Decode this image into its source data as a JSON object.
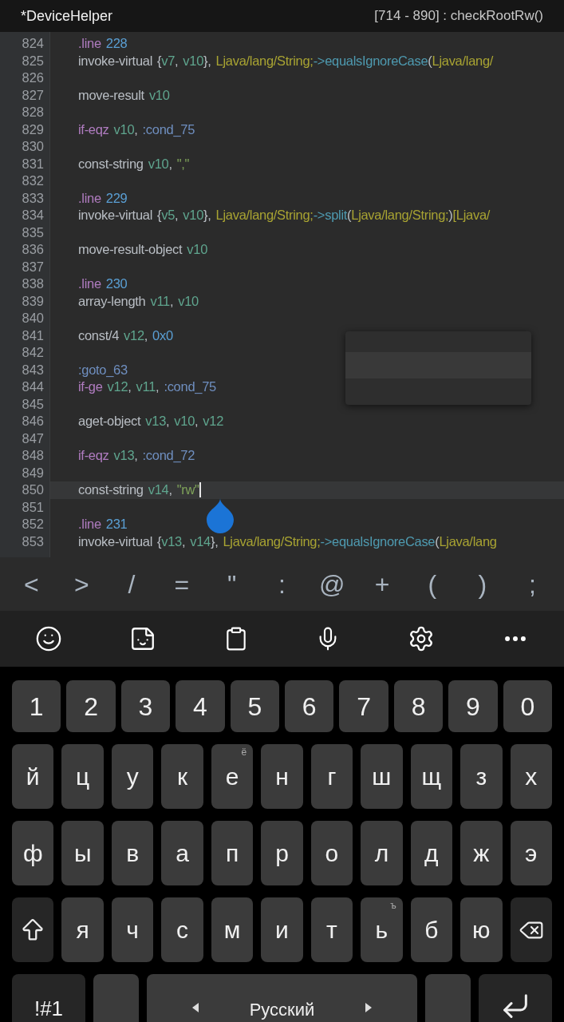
{
  "header": {
    "file_title": "*DeviceHelper",
    "method_range": "[714 - 890] : checkRootRw()"
  },
  "code_lines": [
    {
      "number": "824",
      "current": false,
      "words": [
        [
          {
            "kind": "directive",
            "text": ".line"
          }
        ],
        [
          {
            "kind": "num",
            "text": "228"
          }
        ]
      ]
    },
    {
      "number": "825",
      "current": false,
      "words": [
        [
          {
            "kind": "instr",
            "text": "invoke-virtual"
          }
        ],
        [
          {
            "kind": "punct",
            "text": "{"
          },
          {
            "kind": "reg",
            "text": "v7"
          },
          {
            "kind": "punct",
            "text": ","
          }
        ],
        [
          {
            "kind": "reg",
            "text": "v10"
          },
          {
            "kind": "punct",
            "text": "},"
          }
        ],
        [
          {
            "kind": "type",
            "text": "Ljava/lang/String;"
          },
          {
            "kind": "method",
            "text": "->equalsIgnoreCase"
          },
          {
            "kind": "punct",
            "text": "("
          },
          {
            "kind": "type",
            "text": "Ljava/lang/"
          }
        ]
      ]
    },
    {
      "number": "826",
      "current": false
    },
    {
      "number": "827",
      "current": false,
      "words": [
        [
          {
            "kind": "instr",
            "text": "move-result"
          }
        ],
        [
          {
            "kind": "reg",
            "text": "v10"
          }
        ]
      ]
    },
    {
      "number": "828",
      "current": false
    },
    {
      "number": "829",
      "current": false,
      "words": [
        [
          {
            "kind": "directive",
            "text": "if-eqz"
          }
        ],
        [
          {
            "kind": "reg",
            "text": "v10"
          },
          {
            "kind": "punct",
            "text": ","
          }
        ],
        [
          {
            "kind": "label",
            "text": ":cond_75"
          }
        ]
      ]
    },
    {
      "number": "830",
      "current": false
    },
    {
      "number": "831",
      "current": false,
      "words": [
        [
          {
            "kind": "instr",
            "text": "const-string"
          }
        ],
        [
          {
            "kind": "reg",
            "text": "v10"
          },
          {
            "kind": "punct",
            "text": ","
          }
        ],
        [
          {
            "kind": "str",
            "text": "\",\""
          }
        ]
      ]
    },
    {
      "number": "832",
      "current": false
    },
    {
      "number": "833",
      "current": false,
      "words": [
        [
          {
            "kind": "directive",
            "text": ".line"
          }
        ],
        [
          {
            "kind": "num",
            "text": "229"
          }
        ]
      ]
    },
    {
      "number": "834",
      "current": false,
      "words": [
        [
          {
            "kind": "instr",
            "text": "invoke-virtual"
          }
        ],
        [
          {
            "kind": "punct",
            "text": "{"
          },
          {
            "kind": "reg",
            "text": "v5"
          },
          {
            "kind": "punct",
            "text": ","
          }
        ],
        [
          {
            "kind": "reg",
            "text": "v10"
          },
          {
            "kind": "punct",
            "text": "},"
          }
        ],
        [
          {
            "kind": "type",
            "text": "Ljava/lang/String;"
          },
          {
            "kind": "method",
            "text": "->split"
          },
          {
            "kind": "punct",
            "text": "("
          },
          {
            "kind": "type",
            "text": "Ljava/lang/String;"
          },
          {
            "kind": "punct",
            "text": ")"
          },
          {
            "kind": "type",
            "text": "[Ljava/"
          }
        ]
      ]
    },
    {
      "number": "835",
      "current": false
    },
    {
      "number": "836",
      "current": false,
      "words": [
        [
          {
            "kind": "instr",
            "text": "move-result-object"
          }
        ],
        [
          {
            "kind": "reg",
            "text": "v10"
          }
        ]
      ]
    },
    {
      "number": "837",
      "current": false
    },
    {
      "number": "838",
      "current": false,
      "words": [
        [
          {
            "kind": "directive",
            "text": ".line"
          }
        ],
        [
          {
            "kind": "num",
            "text": "230"
          }
        ]
      ]
    },
    {
      "number": "839",
      "current": false,
      "words": [
        [
          {
            "kind": "instr",
            "text": "array-length"
          }
        ],
        [
          {
            "kind": "reg",
            "text": "v11"
          },
          {
            "kind": "punct",
            "text": ","
          }
        ],
        [
          {
            "kind": "reg",
            "text": "v10"
          }
        ]
      ]
    },
    {
      "number": "840",
      "current": false
    },
    {
      "number": "841",
      "current": false,
      "words": [
        [
          {
            "kind": "instr",
            "text": "const/4"
          }
        ],
        [
          {
            "kind": "reg",
            "text": "v12"
          },
          {
            "kind": "punct",
            "text": ","
          }
        ],
        [
          {
            "kind": "num",
            "text": "0x0"
          }
        ]
      ]
    },
    {
      "number": "842",
      "current": false
    },
    {
      "number": "843",
      "current": false,
      "words": [
        [
          {
            "kind": "label",
            "text": ":goto_63"
          }
        ]
      ]
    },
    {
      "number": "844",
      "current": false,
      "words": [
        [
          {
            "kind": "directive",
            "text": "if-ge"
          }
        ],
        [
          {
            "kind": "reg",
            "text": "v12"
          },
          {
            "kind": "punct",
            "text": ","
          }
        ],
        [
          {
            "kind": "reg",
            "text": "v11"
          },
          {
            "kind": "punct",
            "text": ","
          }
        ],
        [
          {
            "kind": "label",
            "text": ":cond_75"
          }
        ]
      ]
    },
    {
      "number": "845",
      "current": false
    },
    {
      "number": "846",
      "current": false,
      "words": [
        [
          {
            "kind": "instr",
            "text": "aget-object"
          }
        ],
        [
          {
            "kind": "reg",
            "text": "v13"
          },
          {
            "kind": "punct",
            "text": ","
          }
        ],
        [
          {
            "kind": "reg",
            "text": "v10"
          },
          {
            "kind": "punct",
            "text": ","
          }
        ],
        [
          {
            "kind": "reg",
            "text": "v12"
          }
        ]
      ]
    },
    {
      "number": "847",
      "current": false
    },
    {
      "number": "848",
      "current": false,
      "words": [
        [
          {
            "kind": "directive",
            "text": "if-eqz"
          }
        ],
        [
          {
            "kind": "reg",
            "text": "v13"
          },
          {
            "kind": "punct",
            "text": ","
          }
        ],
        [
          {
            "kind": "label",
            "text": ":cond_72"
          }
        ]
      ]
    },
    {
      "number": "849",
      "current": false
    },
    {
      "number": "850",
      "current": true,
      "words": [
        [
          {
            "kind": "instr",
            "text": "const-string"
          }
        ],
        [
          {
            "kind": "reg",
            "text": "v14"
          },
          {
            "kind": "punct",
            "text": ","
          }
        ],
        [
          {
            "kind": "str",
            "text": "\"rw\""
          }
        ]
      ]
    },
    {
      "number": "851",
      "current": false
    },
    {
      "number": "852",
      "current": false,
      "words": [
        [
          {
            "kind": "directive",
            "text": ".line"
          }
        ],
        [
          {
            "kind": "num",
            "text": "231"
          }
        ]
      ]
    },
    {
      "number": "853",
      "current": false,
      "words": [
        [
          {
            "kind": "instr",
            "text": "invoke-virtual"
          }
        ],
        [
          {
            "kind": "punct",
            "text": "{"
          },
          {
            "kind": "reg",
            "text": "v13"
          },
          {
            "kind": "punct",
            "text": ","
          }
        ],
        [
          {
            "kind": "reg",
            "text": "v14"
          },
          {
            "kind": "punct",
            "text": "},"
          }
        ],
        [
          {
            "kind": "type",
            "text": "Ljava/lang/String;"
          },
          {
            "kind": "method",
            "text": "->equalsIgnoreCase"
          },
          {
            "kind": "punct",
            "text": "("
          },
          {
            "kind": "type",
            "text": "Ljava/lang"
          }
        ]
      ]
    }
  ],
  "extra_keys": [
    "<",
    ">",
    "/",
    "=",
    "\"",
    ":",
    "@",
    "+",
    "(",
    ")",
    ";"
  ],
  "keyboard": {
    "number_row": [
      "1",
      "2",
      "3",
      "4",
      "5",
      "6",
      "7",
      "8",
      "9",
      "0"
    ],
    "letter_rows": [
      [
        {
          "kind": "letter",
          "label": "й"
        },
        {
          "kind": "letter",
          "label": "ц"
        },
        {
          "kind": "letter",
          "label": "у"
        },
        {
          "kind": "letter",
          "label": "к"
        },
        {
          "kind": "letter",
          "label": "е",
          "hint": "ё"
        },
        {
          "kind": "letter",
          "label": "н"
        },
        {
          "kind": "letter",
          "label": "г"
        },
        {
          "kind": "letter",
          "label": "ш"
        },
        {
          "kind": "letter",
          "label": "щ"
        },
        {
          "kind": "letter",
          "label": "з"
        },
        {
          "kind": "letter",
          "label": "х"
        }
      ],
      [
        {
          "kind": "letter",
          "label": "ф"
        },
        {
          "kind": "letter",
          "label": "ы"
        },
        {
          "kind": "letter",
          "label": "в"
        },
        {
          "kind": "letter",
          "label": "а"
        },
        {
          "kind": "letter",
          "label": "п"
        },
        {
          "kind": "letter",
          "label": "р"
        },
        {
          "kind": "letter",
          "label": "о"
        },
        {
          "kind": "letter",
          "label": "л"
        },
        {
          "kind": "letter",
          "label": "д"
        },
        {
          "kind": "letter",
          "label": "ж"
        },
        {
          "kind": "letter",
          "label": "э"
        }
      ],
      [
        {
          "kind": "shift"
        },
        {
          "kind": "letter",
          "label": "я"
        },
        {
          "kind": "letter",
          "label": "ч"
        },
        {
          "kind": "letter",
          "label": "с"
        },
        {
          "kind": "letter",
          "label": "м"
        },
        {
          "kind": "letter",
          "label": "и"
        },
        {
          "kind": "letter",
          "label": "т"
        },
        {
          "kind": "letter",
          "label": "ь",
          "hint": "ъ"
        },
        {
          "kind": "letter",
          "label": "б"
        },
        {
          "kind": "letter",
          "label": "ю"
        },
        {
          "kind": "backspace"
        }
      ],
      [
        {
          "kind": "symbols",
          "label": "!#1"
        },
        {
          "kind": "blank"
        },
        {
          "kind": "space",
          "label": "Русский"
        },
        {
          "kind": "blank"
        },
        {
          "kind": "enter"
        }
      ]
    ]
  }
}
